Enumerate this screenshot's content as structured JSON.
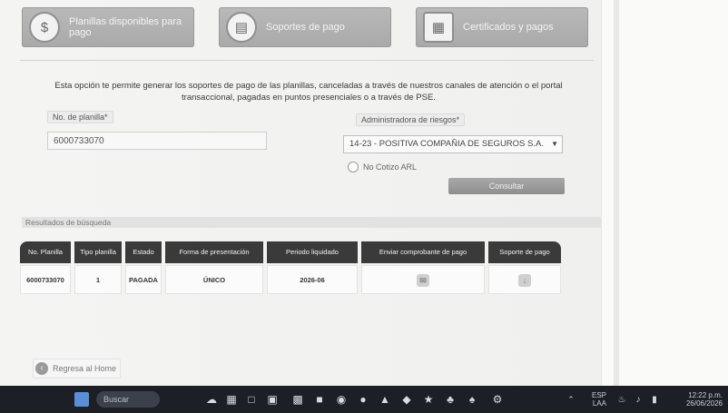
{
  "tabs": [
    {
      "label": "Planillas disponibles para pago",
      "icon": "coins-icon"
    },
    {
      "label": "Soportes de pago",
      "icon": "receipt-icon"
    },
    {
      "label": "Certificados y pagos",
      "icon": "certificate-icon"
    }
  ],
  "info_text": "Esta opción te permite generar los soportes de pago de las planillas, canceladas a través de nuestros canales de atención o el portal transaccional, pagadas en puntos presenciales o a través de PSE.",
  "form": {
    "policy_label": "No. de planilla*",
    "policy_value": "6000733070",
    "admin_label": "Administradora de riesgos*",
    "admin_value": "14-23 - POSITIVA COMPAÑIA DE SEGUROS S.A.",
    "radio_label": "No Cotizo ARL",
    "consult_button": "Consultar"
  },
  "results": {
    "section_label": "Resultados de búsqueda",
    "columns": [
      "No. Planilla",
      "Tipo planilla",
      "Estado",
      "Forma de presentación",
      "Periodo liquidado",
      "Enviar comprobante de pago",
      "Soporte de pago"
    ],
    "rows": [
      {
        "planilla": "6000733070",
        "tipo": "1",
        "estado": "PAGADA",
        "forma": "ÚNICO",
        "periodo": "2026-06"
      }
    ]
  },
  "back_link": "Regresa al Home",
  "taskbar": {
    "search_placeholder": "Buscar",
    "lang_top": "ESP",
    "lang_bottom": "LAA",
    "time": "12:22 p.m.",
    "date": "26/06/2026"
  }
}
